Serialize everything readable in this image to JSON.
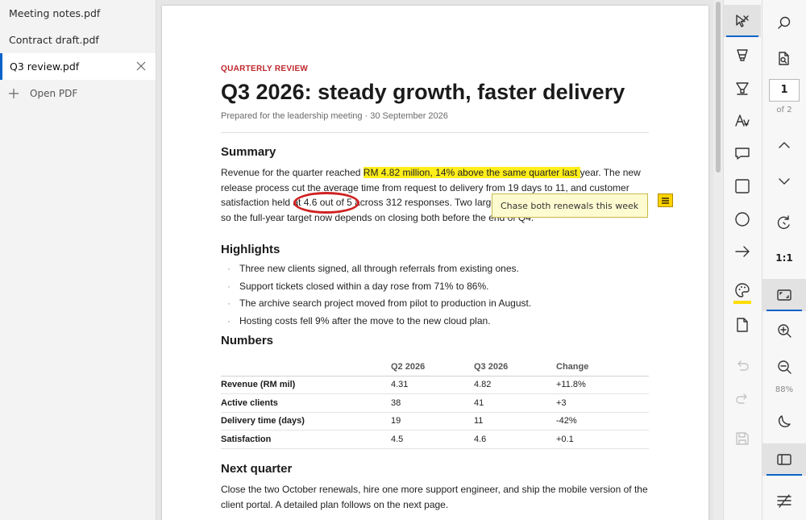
{
  "files": {
    "items": [
      {
        "label": "Meeting notes.pdf",
        "active": false
      },
      {
        "label": "Contract draft.pdf",
        "active": false
      },
      {
        "label": "Q3 review.pdf",
        "active": true
      }
    ],
    "open_label": "Open PDF"
  },
  "doc": {
    "kicker": "QUARTERLY REVIEW",
    "title": "Q3 2026: steady growth, faster delivery",
    "subtitle": "Prepared for the leadership meeting  ·  30 September 2026",
    "summary_heading": "Summary",
    "summary": {
      "pre": "Revenue for the quarter reached ",
      "highlight": "RM 4.82 million, 14% above the same quarter last ",
      "mid": "year. The new release process cut the average time from request to delivery from 19 days to 11, and customer satisfaction held at ",
      "circled": "4.6 out of 5",
      "post": " across 312 responses. Two large renewals fall in the fourth quarter, so the full-year target now depends on closing both before the end of Q4."
    },
    "highlights_heading": "Highlights",
    "highlights": [
      "Three new clients signed, all through referrals from existing ones.",
      "Support tickets closed within a day rose from 71% to 86%.",
      "The archive search project moved from pilot to production in August.",
      "Hosting costs fell 9% after the move to the new cloud plan."
    ],
    "numbers_heading": "Numbers",
    "table": {
      "headers": [
        "",
        "Q2 2026",
        "Q3 2026",
        "Change"
      ],
      "rows": [
        [
          "Revenue (RM mil)",
          "4.31",
          "4.82",
          "+11.8%"
        ],
        [
          "Active clients",
          "38",
          "41",
          "+3"
        ],
        [
          "Delivery time (days)",
          "19",
          "11",
          "-42%"
        ],
        [
          "Satisfaction",
          "4.5",
          "4.6",
          "+0.1"
        ]
      ]
    },
    "next_heading": "Next quarter",
    "next_text": "Close the two October renewals, hire one more support engineer, and ship the mobile version of the client portal. A detailed plan follows on the next page."
  },
  "note": {
    "text": "Chase both renewals this week"
  },
  "colors": {
    "accent": "#0a63c9",
    "highlight": "#ffee1a",
    "kicker": "#c0262b",
    "ink_circle": "#cf2222",
    "note": "#ffd400"
  },
  "tools": [
    {
      "icon": "select-tool-icon",
      "active": true
    },
    {
      "icon": "highlighter-icon",
      "active": false
    },
    {
      "icon": "underline-marker-icon",
      "active": false
    },
    {
      "icon": "text-annotation-icon",
      "active": false
    },
    {
      "icon": "comment-icon",
      "active": false
    },
    {
      "icon": "rectangle-icon",
      "active": false
    },
    {
      "icon": "circle-icon",
      "active": false
    },
    {
      "icon": "arrow-icon",
      "active": false
    },
    {
      "icon": "color-palette-icon",
      "active": false
    },
    {
      "icon": "page-icon",
      "active": false
    },
    {
      "icon": "undo-icon",
      "enabled": false
    },
    {
      "icon": "redo-icon",
      "enabled": false
    },
    {
      "icon": "save-icon",
      "enabled": false
    }
  ],
  "nav": {
    "current_page": "1",
    "total_pages": "of 2",
    "fit_label": "1:1",
    "zoom": "88%"
  }
}
